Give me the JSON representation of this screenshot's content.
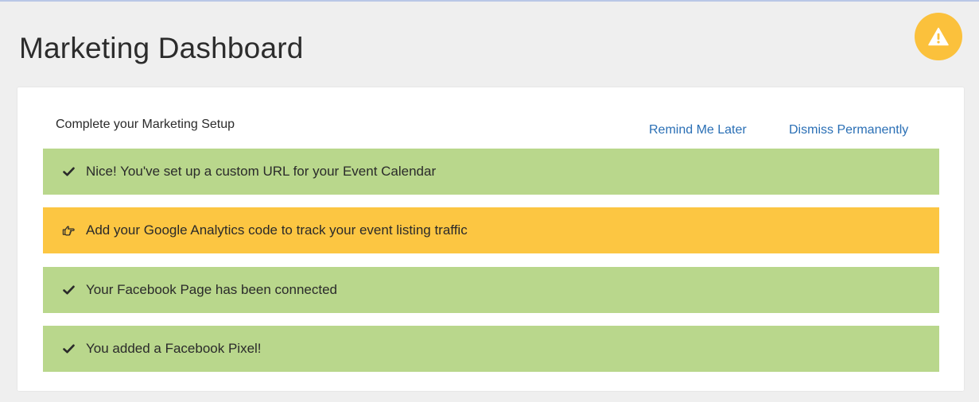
{
  "page": {
    "title": "Marketing Dashboard",
    "alert_icon": "warning-icon",
    "alert_color": "#fbc13c"
  },
  "setup": {
    "heading": "Complete your Marketing Setup",
    "remind_label": "Remind Me Later",
    "dismiss_label": "Dismiss Permanently",
    "items": [
      {
        "status": "done",
        "icon": "checkmark-icon",
        "text": "Nice! You've set up a custom URL for your Event Calendar"
      },
      {
        "status": "todo",
        "icon": "pointing-hand-icon",
        "text": "Add your Google Analytics code to track your event listing traffic"
      },
      {
        "status": "done",
        "icon": "checkmark-icon",
        "text": "Your Facebook Page has been connected"
      },
      {
        "status": "done",
        "icon": "checkmark-icon",
        "text": "You added a Facebook Pixel!"
      }
    ]
  },
  "colors": {
    "done": "#b9d78c",
    "todo": "#fcc642",
    "link": "#2a6fb5",
    "background": "#efefef"
  }
}
